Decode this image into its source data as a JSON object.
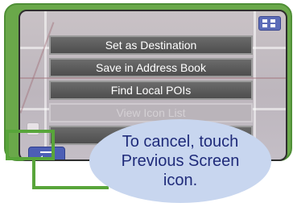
{
  "menu": {
    "items": [
      {
        "label": "Set as Destination",
        "enabled": true
      },
      {
        "label": "Save in Address Book",
        "enabled": true
      },
      {
        "label": "Find Local POIs",
        "enabled": true
      },
      {
        "label": "View Icon List",
        "enabled": false
      },
      {
        "label": "",
        "enabled": true
      }
    ]
  },
  "controls": {
    "grid_icon": "grid-icon",
    "previous_screen_icon": "return-arrow-icon"
  },
  "callout": {
    "text": "To cancel, touch Previous Screen icon."
  },
  "colors": {
    "bezel": "#6aa84a",
    "highlight": "#58a53a",
    "callout_bg": "#c8d6ef",
    "callout_text": "#1f2b7a",
    "button_blue": "#4d5fb5"
  }
}
